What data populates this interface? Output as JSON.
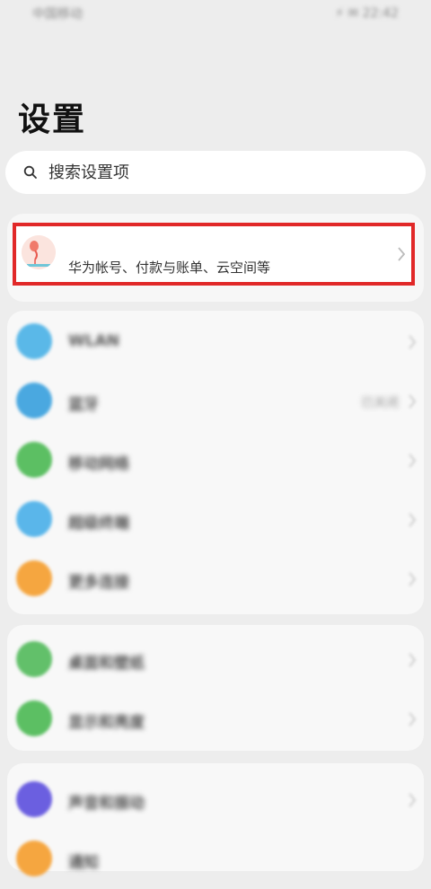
{
  "status": {
    "carrier": "中国移动",
    "signal": "ull",
    "right": "⚡ ✉ 22:42"
  },
  "title": "设置",
  "search": {
    "placeholder": "搜索设置项"
  },
  "account": {
    "subtitle": "华为帐号、付款与账单、云空间等"
  },
  "groups": [
    {
      "items": [
        {
          "label": "WLAN",
          "value": "",
          "icon_color": "#5ab8e8",
          "icon": "wifi-icon"
        },
        {
          "label": "蓝牙",
          "value": "已关闭",
          "icon_color": "#4aa8e0",
          "icon": "bluetooth-icon"
        },
        {
          "label": "移动网络",
          "value": "",
          "icon_color": "#5cbf63",
          "icon": "mobile-network-icon"
        },
        {
          "label": "超级终端",
          "value": "",
          "icon_color": "#5ab6ea",
          "icon": "super-device-icon"
        },
        {
          "label": "更多连接",
          "value": "",
          "icon_color": "#f5a640",
          "icon": "more-connections-icon"
        }
      ]
    },
    {
      "items": [
        {
          "label": "桌面和壁纸",
          "value": "",
          "icon_color": "#62c06a",
          "icon": "wallpaper-icon"
        },
        {
          "label": "显示和亮度",
          "value": "",
          "icon_color": "#5cbf63",
          "icon": "display-icon"
        }
      ]
    },
    {
      "items": [
        {
          "label": "声音和振动",
          "value": "",
          "icon_color": "#6b5fe0",
          "icon": "sound-icon"
        },
        {
          "label": "通知",
          "value": "",
          "icon_color": "#f5a640",
          "icon": "notification-icon"
        }
      ]
    }
  ]
}
